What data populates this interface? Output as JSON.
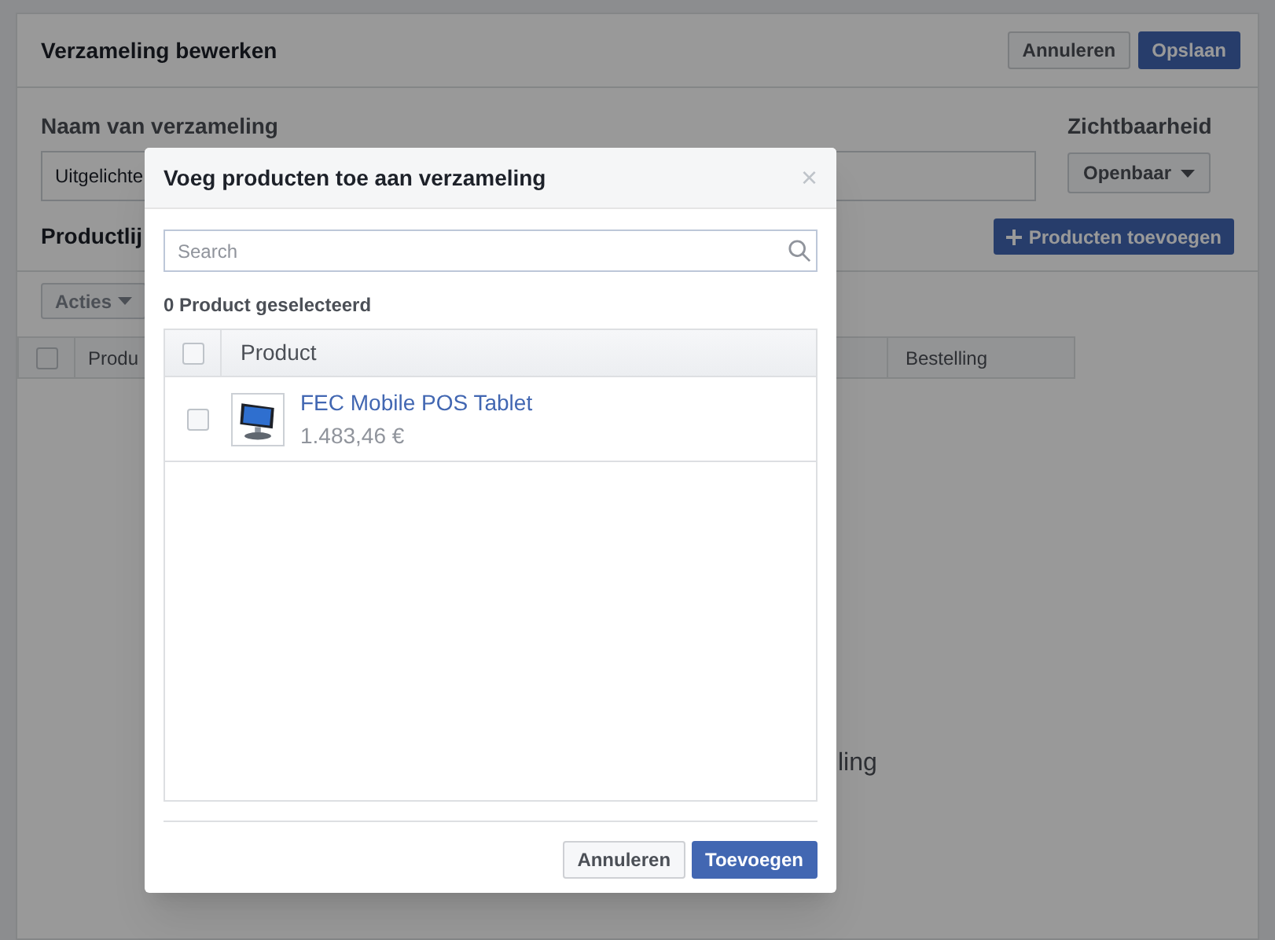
{
  "page": {
    "title": "Verzameling bewerken",
    "buttons": [
      {
        "label": "Annuleren",
        "kind": "secondary"
      },
      {
        "label": "Opslaan",
        "kind": "primary"
      }
    ],
    "name_field": {
      "label": "Naam van verzameling",
      "value": "Uitgelichte"
    },
    "visibility": {
      "label": "Zichtbaarheid",
      "value": "Openbaar"
    },
    "product_list": {
      "label": "Productlij",
      "add_button": "Producten toevoegen",
      "actions_button": "Acties",
      "header_checked": false,
      "columns": [
        "Produ",
        "Bestelling"
      ],
      "empty_text": "ling"
    }
  },
  "dialog": {
    "title": "Voeg producten toe aan verzameling",
    "close": "×",
    "search": {
      "placeholder": "Search"
    },
    "selection_count": "0 Product geselecteerd",
    "table": {
      "header_checked": false,
      "column": "Product",
      "rows": [
        {
          "name": "FEC Mobile POS Tablet",
          "price": "1.483,46 €",
          "checked": false
        }
      ]
    },
    "buttons": [
      {
        "label": "Annuleren",
        "kind": "secondary"
      },
      {
        "label": "Toevoegen",
        "kind": "primary"
      }
    ]
  }
}
